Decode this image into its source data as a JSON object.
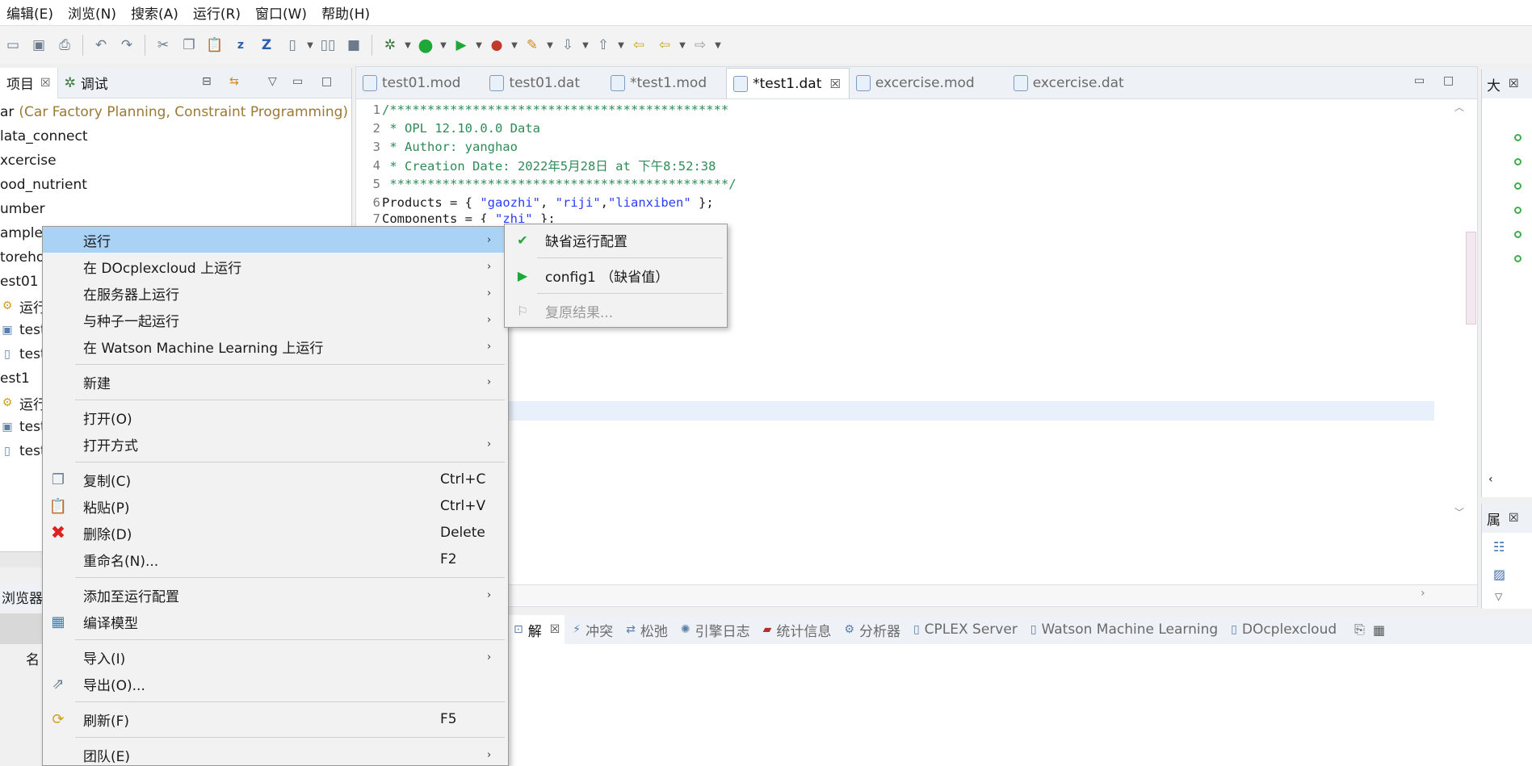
{
  "menubar": {
    "items": [
      "编辑(E)",
      "浏览(N)",
      "搜索(A)",
      "运行(R)",
      "窗口(W)",
      "帮助(H)"
    ]
  },
  "left_panel": {
    "tabs": [
      {
        "label": "项目"
      },
      {
        "label": "调试"
      }
    ],
    "tree": [
      {
        "label": "ar",
        "sub": "(Car Factory Planning, Constraint Programming)"
      },
      {
        "label": "lata_connect"
      },
      {
        "label": "xcercise"
      },
      {
        "label": "ood_nutrient"
      },
      {
        "label": "umber"
      },
      {
        "label": "ample"
      },
      {
        "label": "toreho"
      },
      {
        "label": "est01"
      },
      {
        "label": "运行"
      },
      {
        "label": "test"
      },
      {
        "label": "test"
      },
      {
        "label": "est1"
      },
      {
        "label": "运行"
      },
      {
        "label": "test"
      },
      {
        "label": "test"
      }
    ],
    "browser_title": "浏览器",
    "browser_name": "名"
  },
  "editor": {
    "tabs": [
      {
        "label": "test01.mod",
        "active": false
      },
      {
        "label": "test01.dat",
        "active": false
      },
      {
        "label": "*test1.mod",
        "active": false
      },
      {
        "label": "*test1.dat",
        "active": true
      },
      {
        "label": "excercise.mod",
        "active": false
      },
      {
        "label": "excercise.dat",
        "active": false
      }
    ],
    "lines": [
      {
        "n": "1",
        "text": "/*********************************************"
      },
      {
        "n": "2",
        "text": " * OPL 12.10.0.0 Data"
      },
      {
        "n": "3",
        "text": " * Author: yanghao"
      },
      {
        "n": "4",
        "text": " * Creation Date: 2022年5月28日 at 下午8:52:38"
      },
      {
        "n": "5",
        "text": " *********************************************/"
      },
      {
        "n": "6",
        "prefix": "Products = { ",
        "s1": "\"gaozhi\"",
        "m1": ", ",
        "s2": "\"riji\"",
        "m2": ",",
        "s3": "\"lianxiben\"",
        "suffix": " };"
      },
      {
        "n": "7",
        "prefix": "Components = { ",
        "s1": "\"zhi\"",
        "suffix": " };"
      }
    ]
  },
  "right_panel": {
    "title": "大",
    "bottom_title": "属"
  },
  "bottom_tabs": [
    {
      "label": "解",
      "active": true
    },
    {
      "label": "冲突"
    },
    {
      "label": "松弛"
    },
    {
      "label": "引擎日志"
    },
    {
      "label": "统计信息"
    },
    {
      "label": "分析器"
    },
    {
      "label": "CPLEX Server"
    },
    {
      "label": "Watson Machine Learning"
    },
    {
      "label": "DOcplexcloud"
    }
  ],
  "context_menu": {
    "items": [
      {
        "label": "运行",
        "arrow": "›"
      },
      {
        "label": "在 DOcplexcloud 上运行",
        "arrow": "›"
      },
      {
        "label": "在服务器上运行",
        "arrow": "›"
      },
      {
        "label": "与种子一起运行",
        "arrow": "›"
      },
      {
        "label": "在 Watson Machine Learning 上运行",
        "arrow": "›"
      },
      {
        "label": "新建",
        "arrow": "›"
      },
      {
        "label": "打开(O)"
      },
      {
        "label": "打开方式",
        "arrow": "›"
      },
      {
        "label": "复制(C)",
        "shortcut": "Ctrl+C"
      },
      {
        "label": "粘贴(P)",
        "shortcut": "Ctrl+V"
      },
      {
        "label": "删除(D)",
        "shortcut": "Delete"
      },
      {
        "label": "重命名(N)...",
        "shortcut": "F2"
      },
      {
        "label": "添加至运行配置",
        "arrow": "›"
      },
      {
        "label": "编译模型"
      },
      {
        "label": "导入(I)",
        "arrow": "›"
      },
      {
        "label": "导出(O)..."
      },
      {
        "label": "刷新(F)",
        "shortcut": "F5"
      },
      {
        "label": "团队(E)",
        "arrow": "›"
      }
    ]
  },
  "submenu": {
    "items": [
      {
        "label": "缺省运行配置"
      },
      {
        "label": "config1 （缺省值）"
      },
      {
        "label": "复原结果...",
        "disabled": true
      }
    ]
  },
  "colors": {
    "highlight": "#aad2f5",
    "comment": "#2e8b57",
    "string": "#2a3cff",
    "run_green": "#1fa83a",
    "delete_red": "#e02020"
  }
}
